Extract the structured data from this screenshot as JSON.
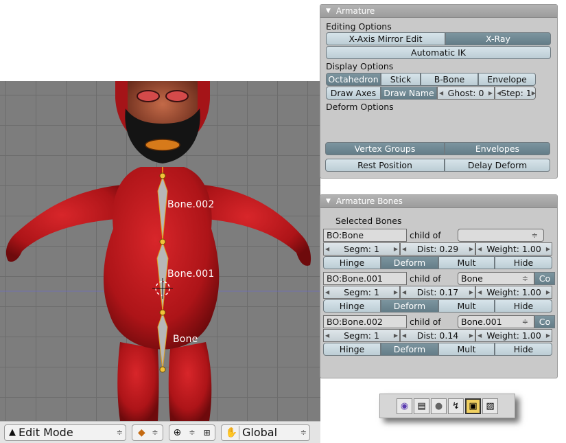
{
  "viewport": {
    "bone_labels": [
      "Bone.002",
      "Bone.001",
      "Bone"
    ]
  },
  "header_bar": {
    "mode_label": "Edit Mode",
    "orientation_label": "Global",
    "mode_icon": "edit-mode-icon",
    "shading_icon": "solid-shading-icon",
    "pivot_icon": "pivot-crosshair-icon",
    "snap_icon": "grid-snap-icon",
    "hand_icon": "transform-manipulator-icon"
  },
  "armature_panel": {
    "title": "Armature",
    "editing_options_label": "Editing Options",
    "x_axis_mirror_edit": "X-Axis Mirror Edit",
    "x_ray": "X-Ray",
    "automatic_ik": "Automatic IK",
    "display_options_label": "Display Options",
    "octahedron": "Octahedron",
    "stick": "Stick",
    "b_bone": "B-Bone",
    "envelope": "Envelope",
    "draw_axes": "Draw Axes",
    "draw_name": "Draw Name",
    "ghost": "Ghost: 0",
    "step": "Step: 1",
    "deform_options_label": "Deform Options",
    "vertex_groups": "Vertex Groups",
    "envelopes": "Envelopes",
    "rest_position": "Rest Position",
    "delay_deform": "Delay Deform"
  },
  "bones_panel": {
    "title": "Armature Bones",
    "selected_bones_label": "Selected Bones",
    "bones": [
      {
        "name": "BO:Bone",
        "child_of_label": "child of",
        "parent": "",
        "parent_arrow": "≑",
        "extra": "",
        "segm": "Segm: 1",
        "dist": "Dist: 0.29",
        "weight": "Weight: 1.00",
        "hinge": "Hinge",
        "deform": "Deform",
        "mult": "Mult",
        "hide": "Hide"
      },
      {
        "name": "BO:Bone.001",
        "child_of_label": "child of",
        "parent": "Bone",
        "parent_arrow": "≑",
        "extra": "Co",
        "segm": "Segm: 1",
        "dist": "Dist: 0.17",
        "weight": "Weight: 1.00",
        "hinge": "Hinge",
        "deform": "Deform",
        "mult": "Mult",
        "hide": "Hide"
      },
      {
        "name": "BO:Bone.002",
        "child_of_label": "child of",
        "parent": "Bone.001",
        "parent_arrow": "≑",
        "extra": "Co",
        "segm": "Segm: 1",
        "dist": "Dist: 0.14",
        "weight": "Weight: 1.00",
        "hinge": "Hinge",
        "deform": "Deform",
        "mult": "Mult",
        "hide": "Hide"
      }
    ]
  },
  "toolbar_icons": [
    "logic-icon",
    "script-icon",
    "shading-sphere-icon",
    "object-icon",
    "editing-icon",
    "scene-icon"
  ],
  "colors": {
    "toggle_on": "#6f8893",
    "toggle_off": "#c6d6dd",
    "panel_bg": "#c9c9c9",
    "character_red": "#b4181c"
  }
}
